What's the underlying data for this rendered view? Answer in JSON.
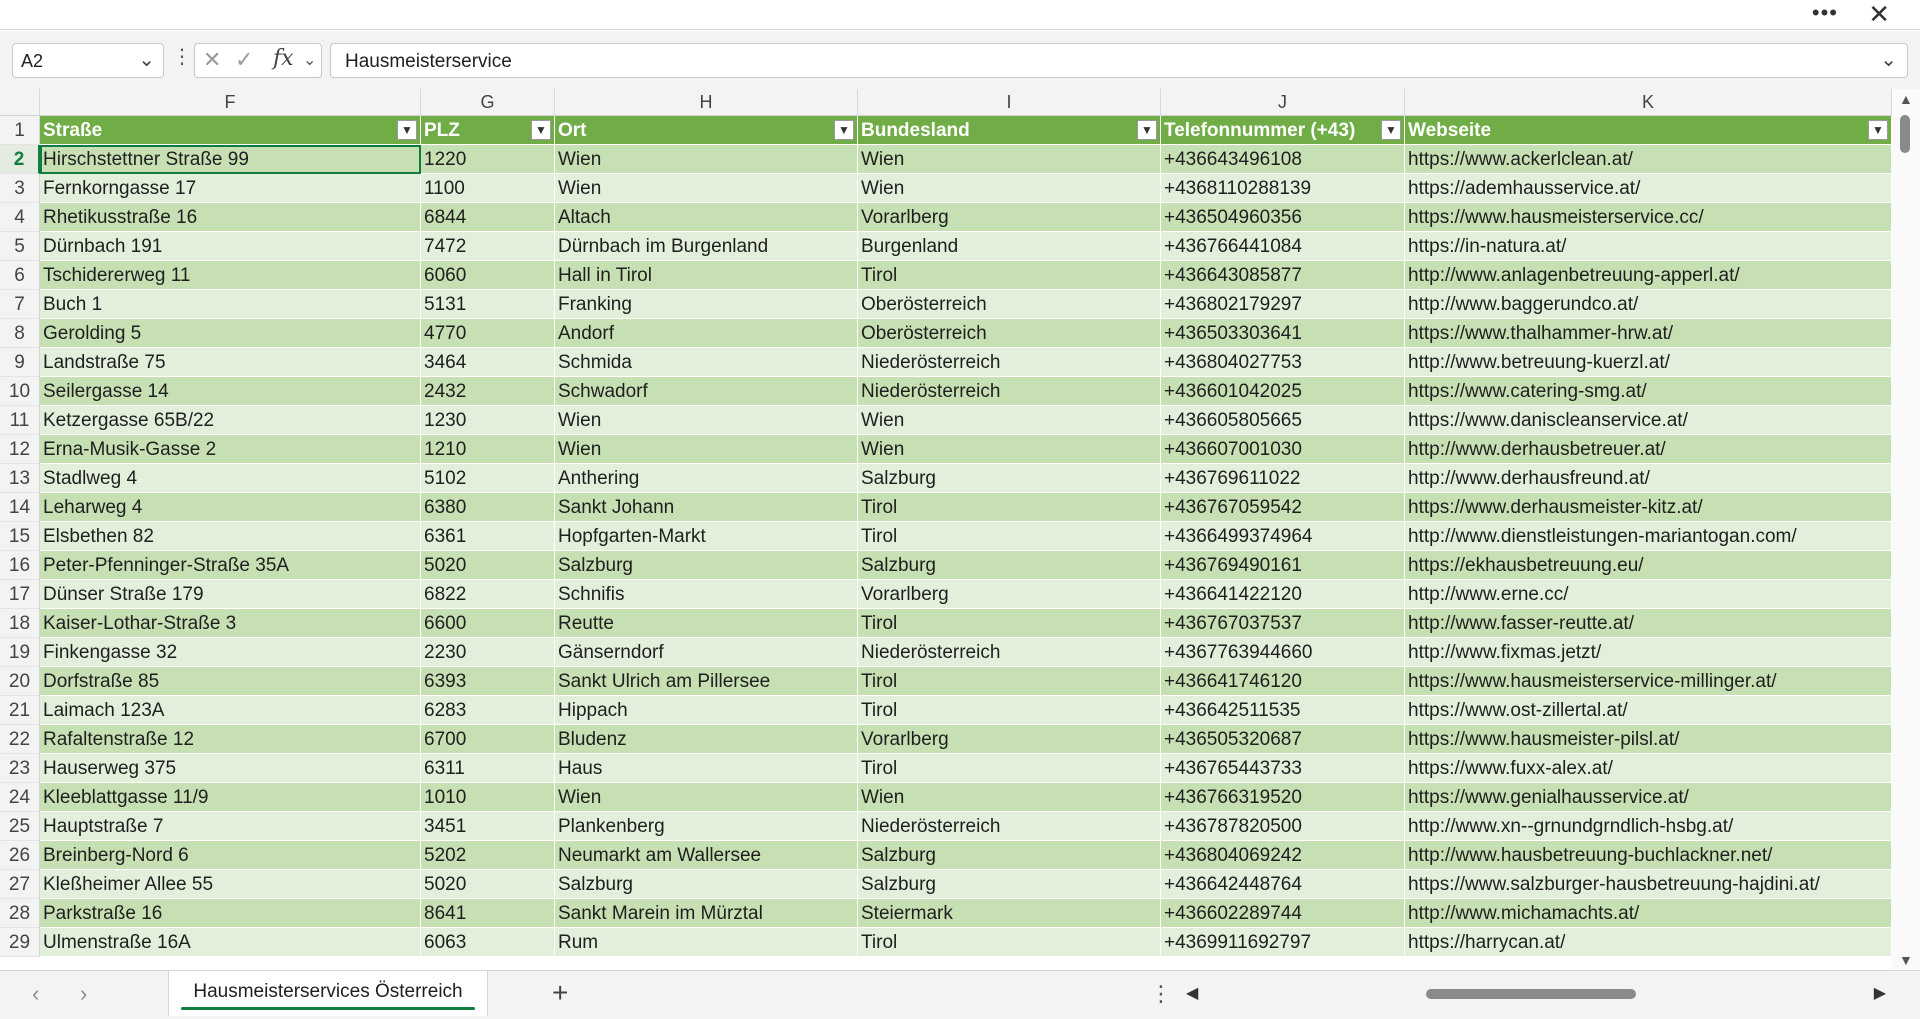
{
  "window": {
    "more_icon": "ellipsis-icon",
    "close_icon": "close-icon"
  },
  "formula_bar": {
    "name_box": "A2",
    "formula": "Hausmeisterservice",
    "fx_label": "fx"
  },
  "columns": [
    {
      "letter": "F",
      "header": "Straße"
    },
    {
      "letter": "G",
      "header": "PLZ"
    },
    {
      "letter": "H",
      "header": "Ort"
    },
    {
      "letter": "I",
      "header": "Bundesland"
    },
    {
      "letter": "J",
      "header": "Telefonnummer (+43)"
    },
    {
      "letter": "K",
      "header": "Webseite"
    }
  ],
  "rows": [
    {
      "n": "2",
      "cells": [
        "Hirschstettner Straße 99",
        "1220",
        "Wien",
        "Wien",
        "+436643496108",
        "https://www.ackerlclean.at/"
      ]
    },
    {
      "n": "3",
      "cells": [
        "Fernkorngasse 17",
        "1100",
        "Wien",
        "Wien",
        "+4368110288139",
        "https://ademhausservice.at/"
      ]
    },
    {
      "n": "4",
      "cells": [
        "Rhetikusstraße 16",
        "6844",
        "Altach",
        "Vorarlberg",
        "+436504960356",
        "https://www.hausmeisterservice.cc/"
      ]
    },
    {
      "n": "5",
      "cells": [
        "Dürnbach 191",
        "7472",
        "Dürnbach im Burgenland",
        "Burgenland",
        "+436766441084",
        "https://in-natura.at/"
      ]
    },
    {
      "n": "6",
      "cells": [
        "Tschidererweg 11",
        "6060",
        "Hall in Tirol",
        "Tirol",
        "+436643085877",
        "http://www.anlagenbetreuung-apperl.at/"
      ]
    },
    {
      "n": "7",
      "cells": [
        "Buch 1",
        "5131",
        "Franking",
        "Oberösterreich",
        "+436802179297",
        "http://www.baggerundco.at/"
      ]
    },
    {
      "n": "8",
      "cells": [
        "Gerolding 5",
        "4770",
        "Andorf",
        "Oberösterreich",
        "+436503303641",
        "https://www.thalhammer-hrw.at/"
      ]
    },
    {
      "n": "9",
      "cells": [
        "Landstraße 75",
        "3464",
        "Schmida",
        "Niederösterreich",
        "+436804027753",
        "http://www.betreuung-kuerzl.at/"
      ]
    },
    {
      "n": "10",
      "cells": [
        "Seilergasse 14",
        "2432",
        "Schwadorf",
        "Niederösterreich",
        "+436601042025",
        "https://www.catering-smg.at/"
      ]
    },
    {
      "n": "11",
      "cells": [
        "Ketzergasse 65B/22",
        "1230",
        "Wien",
        "Wien",
        "+436605805665",
        "https://www.daniscleanservice.at/"
      ]
    },
    {
      "n": "12",
      "cells": [
        "Erna-Musik-Gasse 2",
        "1210",
        "Wien",
        "Wien",
        "+436607001030",
        "http://www.derhausbetreuer.at/"
      ]
    },
    {
      "n": "13",
      "cells": [
        "Stadlweg 4",
        "5102",
        "Anthering",
        "Salzburg",
        "+436769611022",
        "http://www.derhausfreund.at/"
      ]
    },
    {
      "n": "14",
      "cells": [
        "Leharweg 4",
        "6380",
        "Sankt Johann",
        "Tirol",
        "+436767059542",
        "https://www.derhausmeister-kitz.at/"
      ]
    },
    {
      "n": "15",
      "cells": [
        "Elsbethen 82",
        "6361",
        "Hopfgarten-Markt",
        "Tirol",
        "+4366499374964",
        "http://www.dienstleistungen-mariantogan.com/"
      ]
    },
    {
      "n": "16",
      "cells": [
        "Peter-Pfenninger-Straße 35A",
        "5020",
        "Salzburg",
        "Salzburg",
        "+436769490161",
        "https://ekhausbetreuung.eu/"
      ]
    },
    {
      "n": "17",
      "cells": [
        "Dünser Straße 179",
        "6822",
        "Schnifis",
        "Vorarlberg",
        "+436641422120",
        "http://www.erne.cc/"
      ]
    },
    {
      "n": "18",
      "cells": [
        "Kaiser-Lothar-Straße 3",
        "6600",
        "Reutte",
        "Tirol",
        "+436767037537",
        "http://www.fasser-reutte.at/"
      ]
    },
    {
      "n": "19",
      "cells": [
        "Finkengasse 32",
        "2230",
        "Gänserndorf",
        "Niederösterreich",
        "+4367763944660",
        "http://www.fixmas.jetzt/"
      ]
    },
    {
      "n": "20",
      "cells": [
        "Dorfstraße 85",
        "6393",
        "Sankt Ulrich am Pillersee",
        "Tirol",
        "+436641746120",
        "https://www.hausmeisterservice-millinger.at/"
      ]
    },
    {
      "n": "21",
      "cells": [
        "Laimach 123A",
        "6283",
        "Hippach",
        "Tirol",
        "+436642511535",
        "https://www.ost-zillertal.at/"
      ]
    },
    {
      "n": "22",
      "cells": [
        "Rafaltenstraße 12",
        "6700",
        "Bludenz",
        "Vorarlberg",
        "+436505320687",
        "https://www.hausmeister-pilsl.at/"
      ]
    },
    {
      "n": "23",
      "cells": [
        "Hauserweg 375",
        "6311",
        "Haus",
        "Tirol",
        "+436765443733",
        "https://www.fuxx-alex.at/"
      ]
    },
    {
      "n": "24",
      "cells": [
        "Kleeblattgasse 11/9",
        "1010",
        "Wien",
        "Wien",
        "+436766319520",
        "https://www.genialhausservice.at/"
      ]
    },
    {
      "n": "25",
      "cells": [
        "Hauptstraße 7",
        "3451",
        "Plankenberg",
        "Niederösterreich",
        "+436787820500",
        "http://www.xn--grnundgrndlich-hsbg.at/"
      ]
    },
    {
      "n": "26",
      "cells": [
        "Breinberg-Nord 6",
        "5202",
        "Neumarkt am Wallersee",
        "Salzburg",
        "+436804069242",
        "http://www.hausbetreuung-buchlackner.net/"
      ]
    },
    {
      "n": "27",
      "cells": [
        "Kleßheimer Allee 55",
        "5020",
        "Salzburg",
        "Salzburg",
        "+436642448764",
        "https://www.salzburger-hausbetreuung-hajdini.at/"
      ]
    },
    {
      "n": "28",
      "cells": [
        "Parkstraße 16",
        "8641",
        "Sankt Marein im Mürztal",
        "Steiermark",
        "+436602289744",
        "http://www.michamachts.at/"
      ]
    },
    {
      "n": "29",
      "cells": [
        "Ulmenstraße 16A",
        "6063",
        "Rum",
        "Tirol",
        "+4369911692797",
        "https://harrycan.at/"
      ]
    }
  ],
  "sheet_tabs": [
    {
      "label": "Hausmeisterservices Österreich",
      "active": true
    }
  ],
  "colors": {
    "header_fill": "#70ad47",
    "band_dark": "#c6e0b4",
    "band_light": "#e2efda",
    "accent": "#107c41"
  }
}
